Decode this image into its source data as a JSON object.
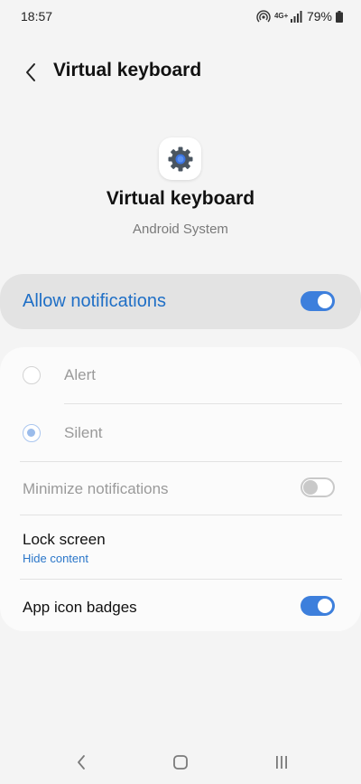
{
  "status_bar": {
    "time": "18:57",
    "network": "4G+",
    "battery": "79%"
  },
  "header": {
    "title": "Virtual keyboard"
  },
  "app": {
    "name": "Virtual keyboard",
    "subtitle": "Android System"
  },
  "allow_notifications": {
    "label": "Allow notifications",
    "enabled": true
  },
  "settings": {
    "alert_label": "Alert",
    "silent_label": "Silent",
    "selected": "Silent",
    "minimize_label": "Minimize notifications",
    "minimize_enabled": false,
    "lock_screen_label": "Lock screen",
    "lock_screen_value": "Hide content",
    "badges_label": "App icon badges",
    "badges_enabled": true
  },
  "colors": {
    "accent": "#3d7fdc",
    "accent_text": "#1f6fc6",
    "background": "#f4f4f4"
  }
}
